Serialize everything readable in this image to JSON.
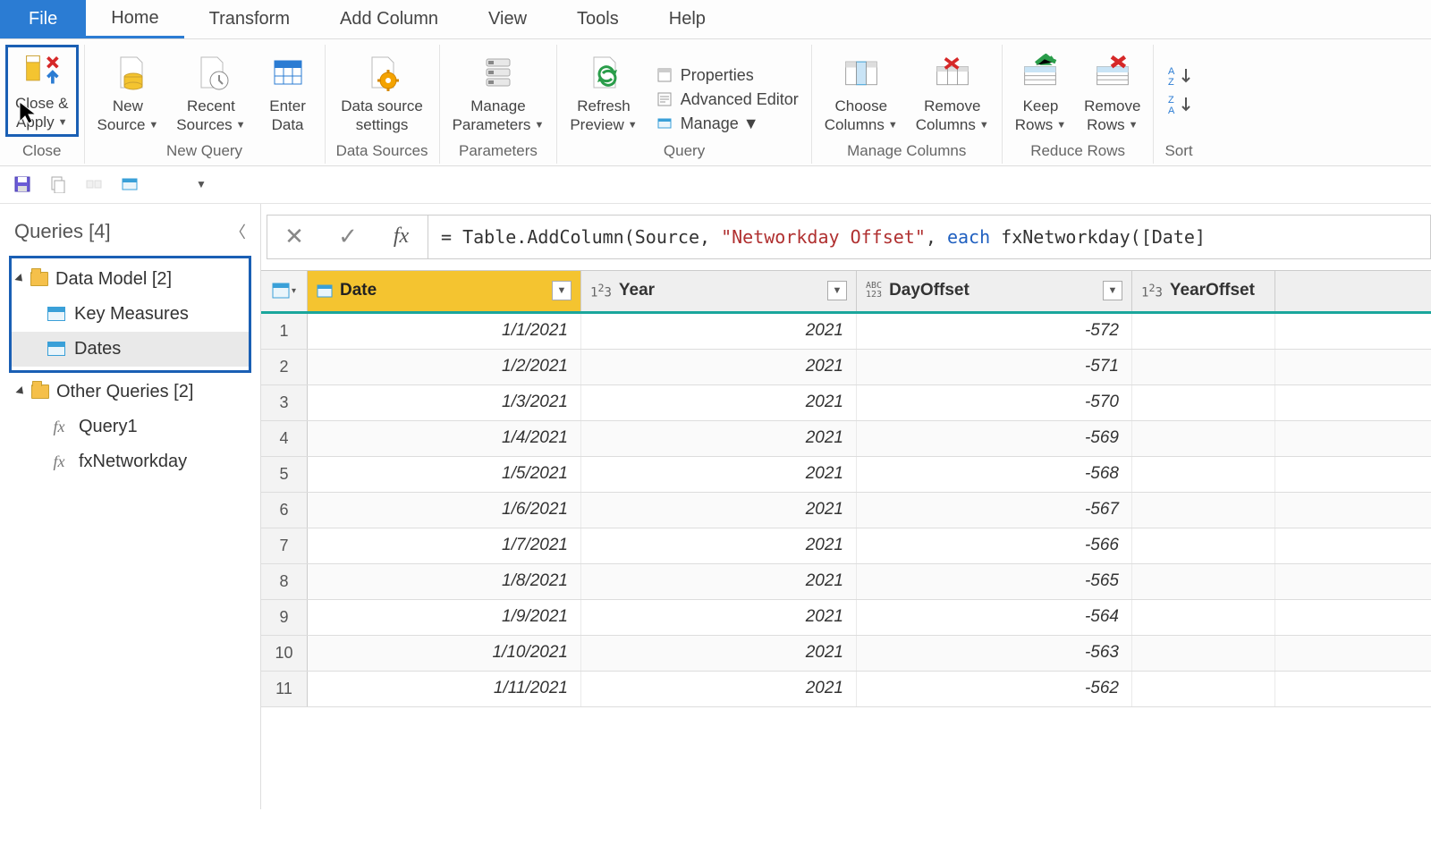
{
  "menu": {
    "tabs": [
      "File",
      "Home",
      "Transform",
      "Add Column",
      "View",
      "Tools",
      "Help"
    ],
    "file_index": 0,
    "active_index": 1
  },
  "ribbon": {
    "groups": [
      {
        "label": "Close",
        "items": [
          {
            "id": "close-apply",
            "label": "Close &\nApply",
            "dropdown": true
          }
        ]
      },
      {
        "label": "New Query",
        "items": [
          {
            "id": "new-source",
            "label": "New\nSource",
            "dropdown": true
          },
          {
            "id": "recent-sources",
            "label": "Recent\nSources",
            "dropdown": true
          },
          {
            "id": "enter-data",
            "label": "Enter\nData",
            "dropdown": false
          }
        ]
      },
      {
        "label": "Data Sources",
        "items": [
          {
            "id": "data-source-settings",
            "label": "Data source\nsettings",
            "dropdown": false
          }
        ]
      },
      {
        "label": "Parameters",
        "items": [
          {
            "id": "manage-parameters",
            "label": "Manage\nParameters",
            "dropdown": true
          }
        ]
      },
      {
        "label": "Query",
        "items": [
          {
            "id": "refresh-preview",
            "label": "Refresh\nPreview",
            "dropdown": true
          }
        ],
        "mini": [
          {
            "id": "properties",
            "label": "Properties"
          },
          {
            "id": "advanced-editor",
            "label": "Advanced Editor"
          },
          {
            "id": "manage",
            "label": "Manage",
            "dropdown": true
          }
        ]
      },
      {
        "label": "Manage Columns",
        "items": [
          {
            "id": "choose-columns",
            "label": "Choose\nColumns",
            "dropdown": true
          },
          {
            "id": "remove-columns",
            "label": "Remove\nColumns",
            "dropdown": true
          }
        ]
      },
      {
        "label": "Reduce Rows",
        "items": [
          {
            "id": "keep-rows",
            "label": "Keep\nRows",
            "dropdown": true
          },
          {
            "id": "remove-rows",
            "label": "Remove\nRows",
            "dropdown": true
          }
        ]
      },
      {
        "label": "Sort",
        "items": [
          {
            "id": "sort-asc",
            "label": "",
            "dropdown": false
          },
          {
            "id": "sort-desc",
            "label": "",
            "dropdown": false
          }
        ]
      }
    ]
  },
  "queries_panel": {
    "title": "Queries [4]",
    "groups": [
      {
        "name": "Data Model [2]",
        "items": [
          {
            "name": "Key Measures",
            "type": "table"
          },
          {
            "name": "Dates",
            "type": "table",
            "selected": true
          }
        ],
        "highlighted": true
      },
      {
        "name": "Other Queries [2]",
        "items": [
          {
            "name": "Query1",
            "type": "fx"
          },
          {
            "name": "fxNetworkday",
            "type": "fx"
          }
        ]
      }
    ]
  },
  "formula": {
    "prefix": "= Table.AddColumn(Source, ",
    "string": "\"Networkday Offset\"",
    "mid": ", ",
    "keyword": "each",
    "suffix": " fxNetworkday([Date]"
  },
  "columns": [
    {
      "name": "Date",
      "type_icon": "date",
      "selected": true,
      "width": "w-date"
    },
    {
      "name": "Year",
      "type_icon": "123",
      "width": "w-year"
    },
    {
      "name": "DayOffset",
      "type_icon": "ABC123",
      "width": "w-day"
    },
    {
      "name": "YearOffset",
      "type_icon": "123",
      "width": "w-yo",
      "no_dropdown": true
    }
  ],
  "rows": [
    {
      "n": 1,
      "Date": "1/1/2021",
      "Year": "2021",
      "DayOffset": "-572",
      "YearOffset": ""
    },
    {
      "n": 2,
      "Date": "1/2/2021",
      "Year": "2021",
      "DayOffset": "-571",
      "YearOffset": ""
    },
    {
      "n": 3,
      "Date": "1/3/2021",
      "Year": "2021",
      "DayOffset": "-570",
      "YearOffset": ""
    },
    {
      "n": 4,
      "Date": "1/4/2021",
      "Year": "2021",
      "DayOffset": "-569",
      "YearOffset": ""
    },
    {
      "n": 5,
      "Date": "1/5/2021",
      "Year": "2021",
      "DayOffset": "-568",
      "YearOffset": ""
    },
    {
      "n": 6,
      "Date": "1/6/2021",
      "Year": "2021",
      "DayOffset": "-567",
      "YearOffset": ""
    },
    {
      "n": 7,
      "Date": "1/7/2021",
      "Year": "2021",
      "DayOffset": "-566",
      "YearOffset": ""
    },
    {
      "n": 8,
      "Date": "1/8/2021",
      "Year": "2021",
      "DayOffset": "-565",
      "YearOffset": ""
    },
    {
      "n": 9,
      "Date": "1/9/2021",
      "Year": "2021",
      "DayOffset": "-564",
      "YearOffset": ""
    },
    {
      "n": 10,
      "Date": "1/10/2021",
      "Year": "2021",
      "DayOffset": "-563",
      "YearOffset": ""
    },
    {
      "n": 11,
      "Date": "1/11/2021",
      "Year": "2021",
      "DayOffset": "-562",
      "YearOffset": ""
    }
  ]
}
